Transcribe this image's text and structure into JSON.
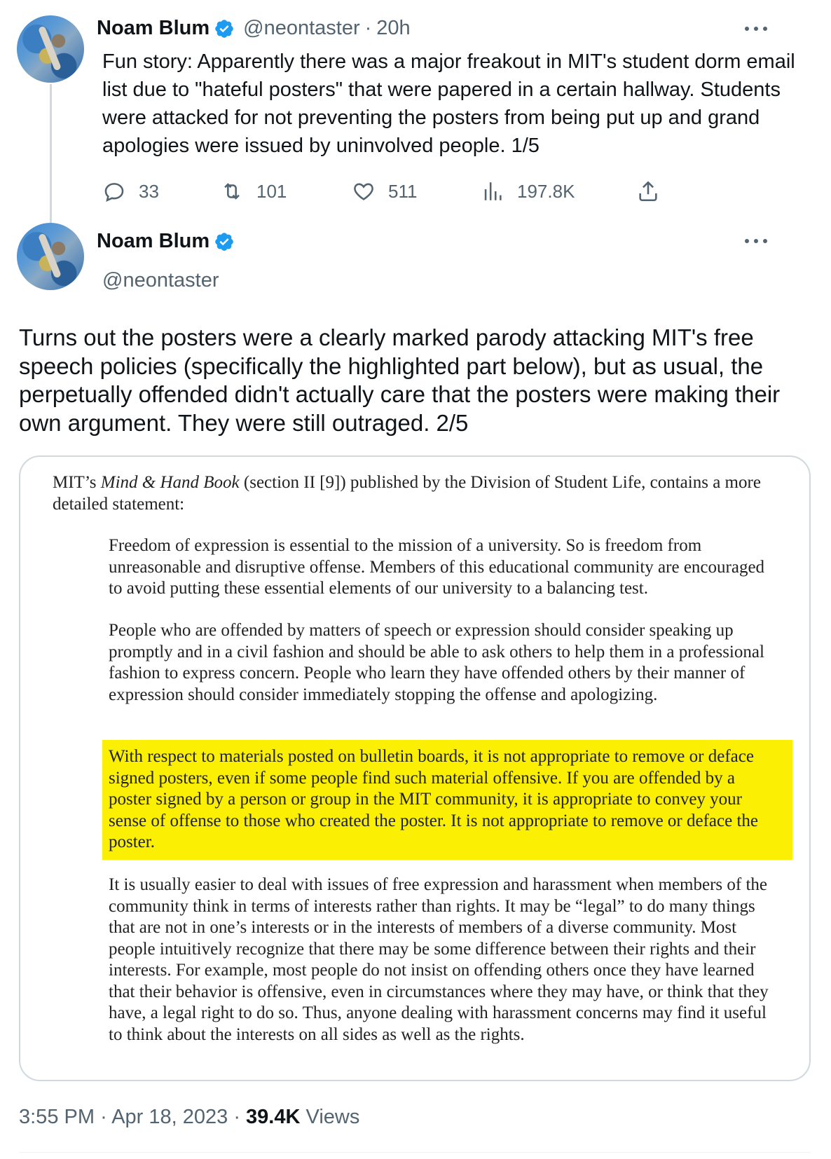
{
  "tweet1": {
    "author_name": "Noam Blum",
    "handle": "@neontaster",
    "time_ago": "20h",
    "text": "Fun story: Apparently there was a major freakout in MIT's student dorm email list due to \"hateful posters\" that were papered in a certain hallway. Students were attacked for not preventing the posters from being put up and grand apologies were issued by uninvolved people. 1/5",
    "replies": "33",
    "retweets": "101",
    "likes": "511",
    "views": "197.8K"
  },
  "tweet2": {
    "author_name": "Noam Blum",
    "handle": "@neontaster",
    "text": "Turns out the posters were a clearly marked parody attacking MIT's free speech policies (specifically the highlighted part below), but as usual, the perpetually offended didn't actually care that the posters were making their own argument. They were still outraged. 2/5",
    "media": {
      "intro_prefix": "MIT’s ",
      "intro_book": "Mind & Hand Book",
      "intro_suffix": " (section II [9]) published by the Division of Student Life, contains a more detailed statement:",
      "para1": "Freedom of expression is essential to the mission of a university. So is freedom from unreasonable and disruptive offense. Members of this educational community are encouraged to avoid putting these essential elements of our university to a balancing test.",
      "para2": "People who are offended by matters of speech or expression should consider speaking up promptly and in a civil fashion and should be able to ask others to help them in a professional fashion to express concern. People who learn they have offended others by their manner of expression should consider immediately stopping the offense and apologizing.",
      "para3": "With respect to materials posted on bulletin boards, it is not appropriate to remove or deface signed posters, even if some people find such material offensive. If you are offended by a poster signed by a person or group in the MIT community, it is appropriate to convey your sense of offense to those who created the poster. It is not appropriate to remove or deface the poster.",
      "para4": "It is usually easier to deal with issues of free expression and harassment when members of the community think in terms of interests rather than rights. It may be “legal” to do many things that are not in one’s interests or in the interests of members of a diverse community. Most people intuitively recognize that there may be some difference between their rights and their interests. For example, most people do not insist on offending others once they have learned that their behavior is offensive, even in circumstances where they may have, or think that they have, a legal right to do so. Thus, anyone dealing with harassment concerns may find it useful to think about the interests on all sides as well as the rights.",
      "highlight_color": "#fbf003"
    },
    "footer": {
      "time": "3:55 PM",
      "date": "Apr 18, 2023",
      "views_count": "39.4K",
      "views_label": "Views"
    }
  },
  "colors": {
    "text": "#0f1419",
    "secondary": "#536471",
    "verified": "#1d9bf0",
    "border": "#cfd9de"
  }
}
